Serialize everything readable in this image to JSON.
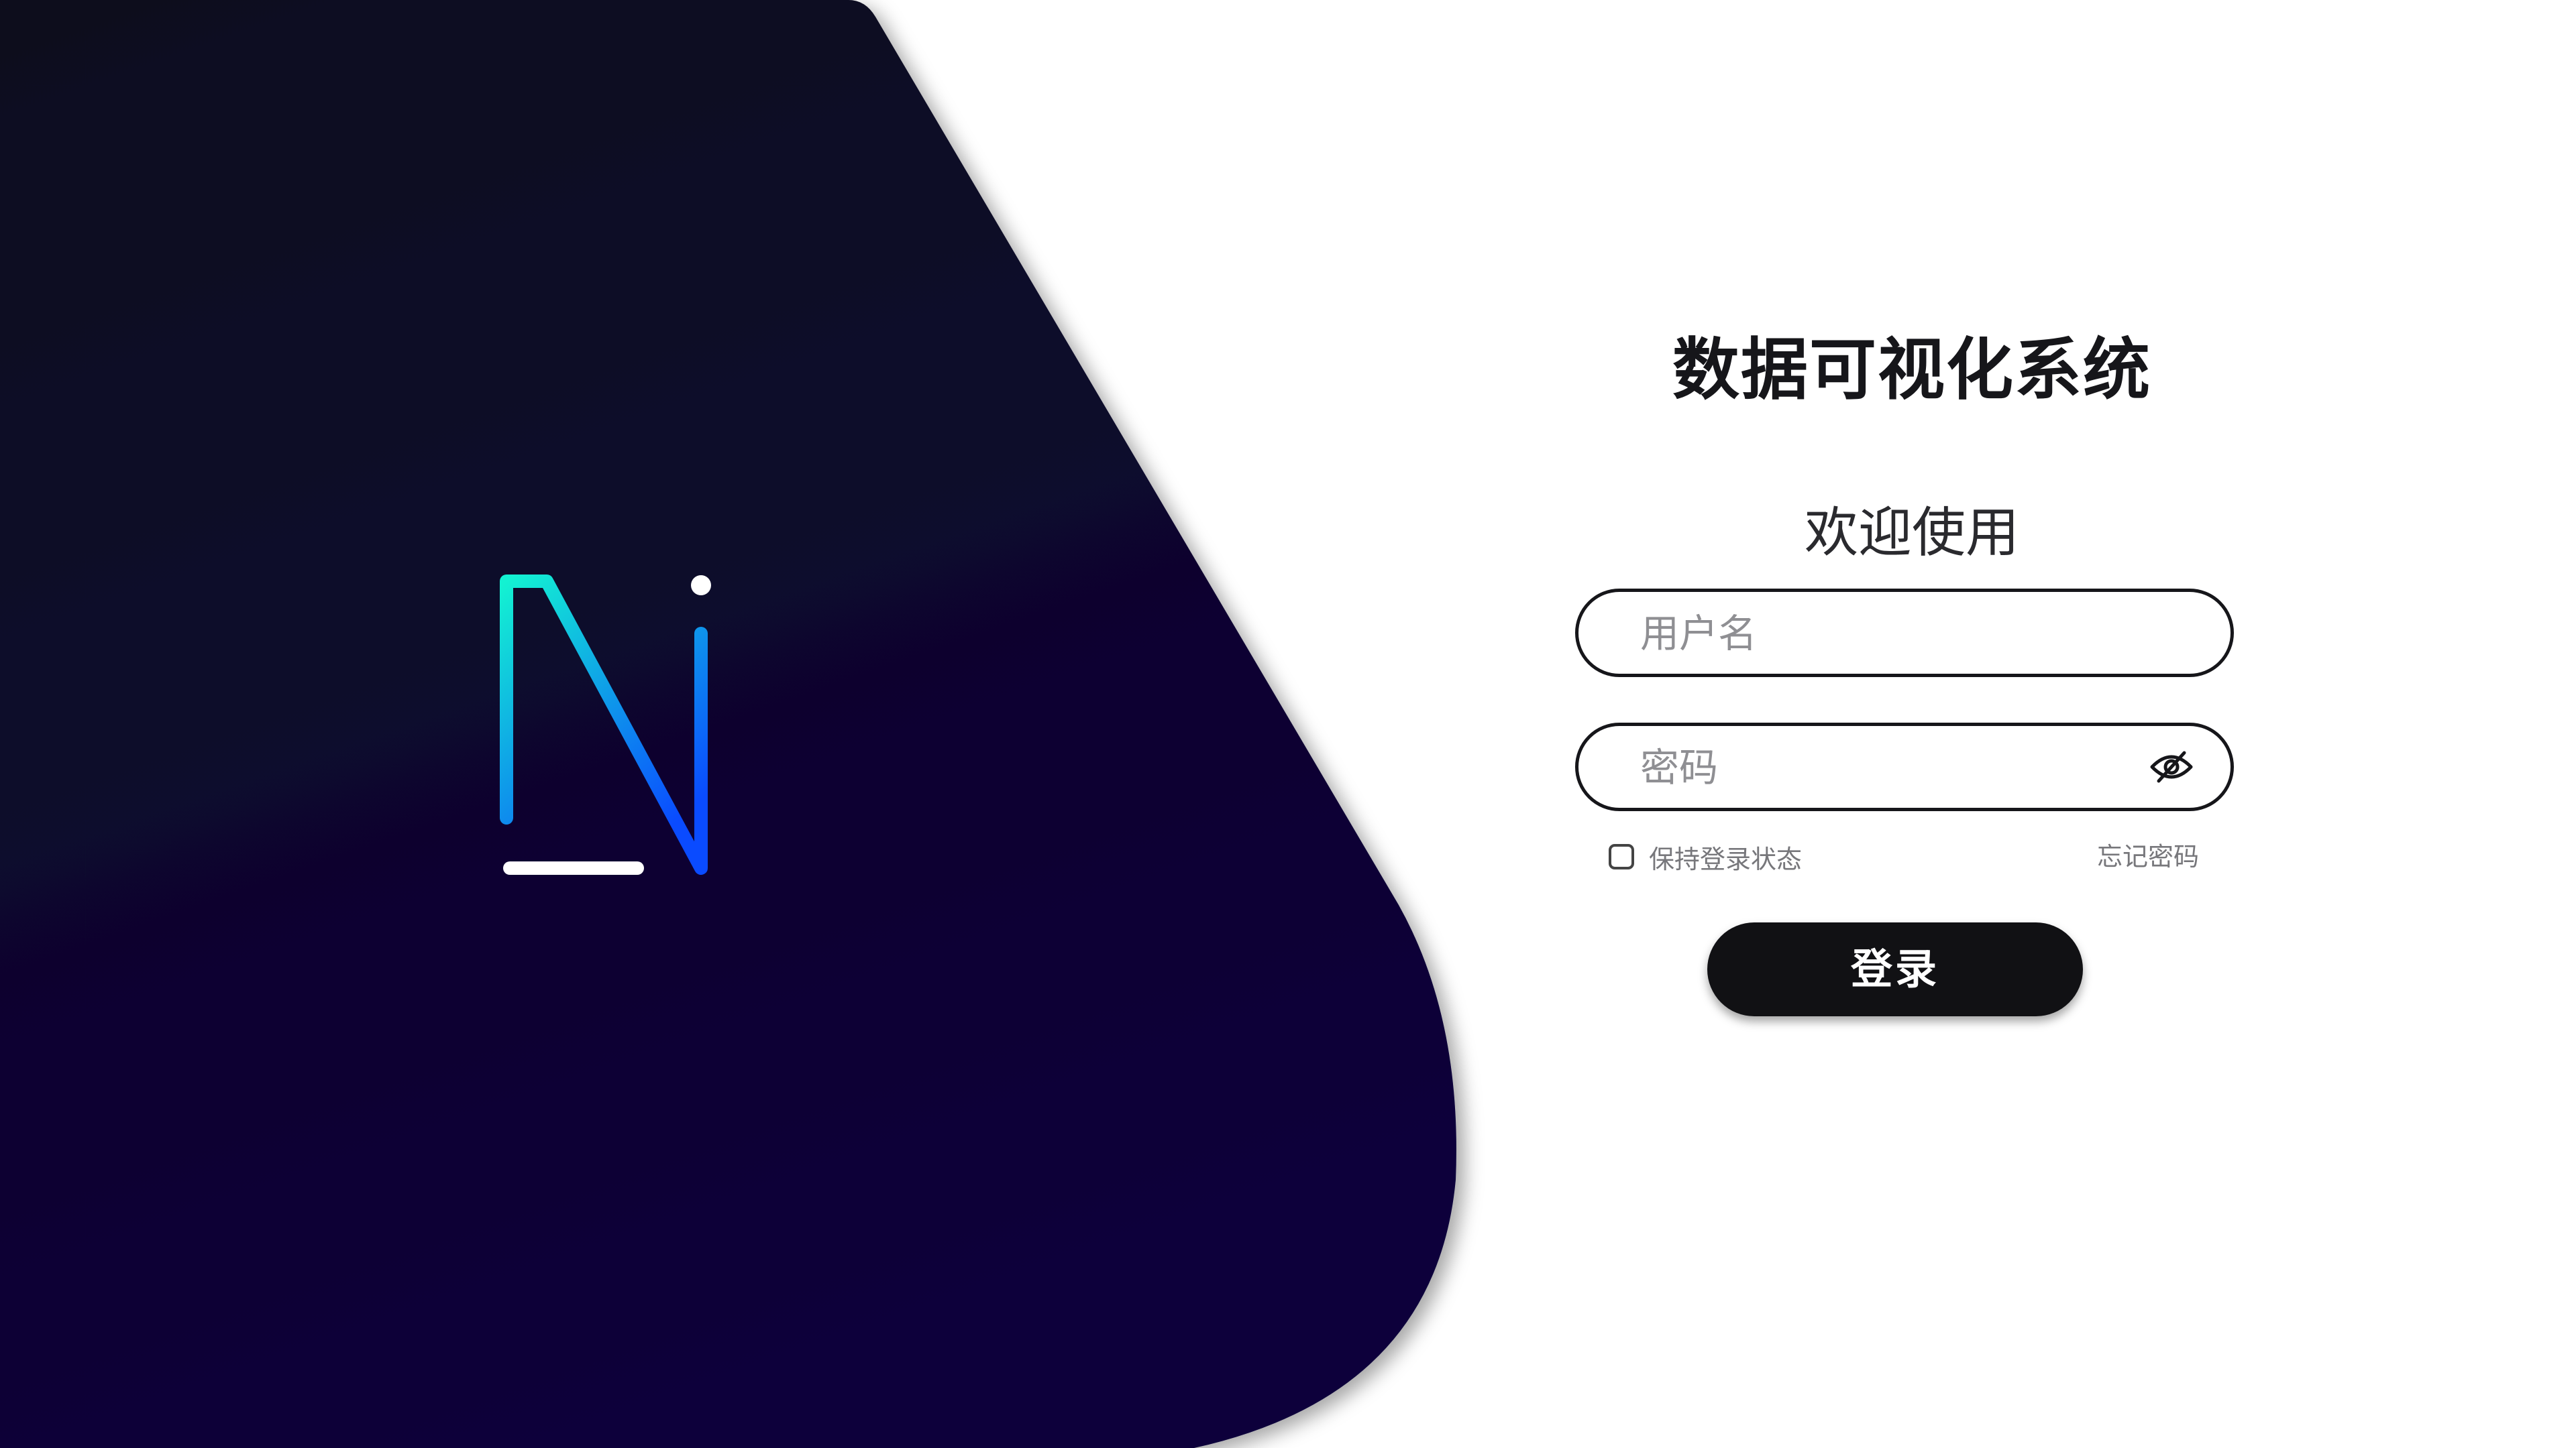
{
  "brand": {
    "logo_icon": "n-logo-icon",
    "gradient_start": "#13f2d2",
    "gradient_end": "#0a4bff",
    "panel_top": "#0f0f1e",
    "panel_bottom": "#08003a"
  },
  "login": {
    "title": "数据可视化系统",
    "welcome": "欢迎使用",
    "username_placeholder": "用户名",
    "username_value": "",
    "password_placeholder": "密码",
    "password_value": "",
    "password_toggle_icon": "eye-off-icon",
    "remember_label": "保持登录状态",
    "remember_checked": false,
    "forgot_label": "忘记密码",
    "submit_label": "登录"
  }
}
